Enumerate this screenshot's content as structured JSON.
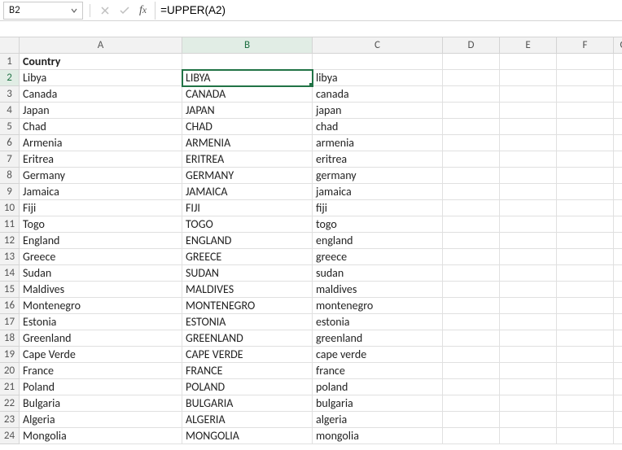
{
  "formulaBar": {
    "nameBoxValue": "B2",
    "formulaText": "=UPPER(A2)"
  },
  "columnHeaders": [
    "A",
    "B",
    "C",
    "D",
    "E",
    "F",
    "G"
  ],
  "selectedCol": "B",
  "selectedRow": 2,
  "rows": [
    {
      "n": 1,
      "a": "Country",
      "b": "",
      "c": "",
      "aBold": true
    },
    {
      "n": 2,
      "a": "Libya",
      "b": "LIBYA",
      "c": "libya"
    },
    {
      "n": 3,
      "a": "Canada",
      "b": "CANADA",
      "c": "canada"
    },
    {
      "n": 4,
      "a": "Japan",
      "b": "JAPAN",
      "c": "japan"
    },
    {
      "n": 5,
      "a": "Chad",
      "b": "CHAD",
      "c": "chad"
    },
    {
      "n": 6,
      "a": "Armenia",
      "b": "ARMENIA",
      "c": "armenia"
    },
    {
      "n": 7,
      "a": "Eritrea",
      "b": "ERITREA",
      "c": "eritrea"
    },
    {
      "n": 8,
      "a": "Germany",
      "b": "GERMANY",
      "c": "germany"
    },
    {
      "n": 9,
      "a": "Jamaica",
      "b": "JAMAICA",
      "c": "jamaica"
    },
    {
      "n": 10,
      "a": "Fiji",
      "b": "FIJI",
      "c": "fiji"
    },
    {
      "n": 11,
      "a": "Togo",
      "b": "TOGO",
      "c": "togo"
    },
    {
      "n": 12,
      "a": "England",
      "b": "ENGLAND",
      "c": "england"
    },
    {
      "n": 13,
      "a": "Greece",
      "b": "GREECE",
      "c": "greece"
    },
    {
      "n": 14,
      "a": "Sudan",
      "b": "SUDAN",
      "c": "sudan"
    },
    {
      "n": 15,
      "a": "Maldives",
      "b": "MALDIVES",
      "c": "maldives"
    },
    {
      "n": 16,
      "a": "Montenegro",
      "b": "MONTENEGRO",
      "c": "montenegro"
    },
    {
      "n": 17,
      "a": "Estonia",
      "b": "ESTONIA",
      "c": "estonia"
    },
    {
      "n": 18,
      "a": "Greenland",
      "b": "GREENLAND",
      "c": "greenland"
    },
    {
      "n": 19,
      "a": "Cape Verde",
      "b": "CAPE VERDE",
      "c": "cape verde"
    },
    {
      "n": 20,
      "a": "France",
      "b": "FRANCE",
      "c": "france"
    },
    {
      "n": 21,
      "a": "Poland",
      "b": "POLAND",
      "c": "poland"
    },
    {
      "n": 22,
      "a": "Bulgaria",
      "b": "BULGARIA",
      "c": "bulgaria"
    },
    {
      "n": 23,
      "a": "Algeria",
      "b": "ALGERIA",
      "c": "algeria"
    },
    {
      "n": 24,
      "a": "Mongolia",
      "b": "MONGOLIA",
      "c": "mongolia"
    }
  ]
}
